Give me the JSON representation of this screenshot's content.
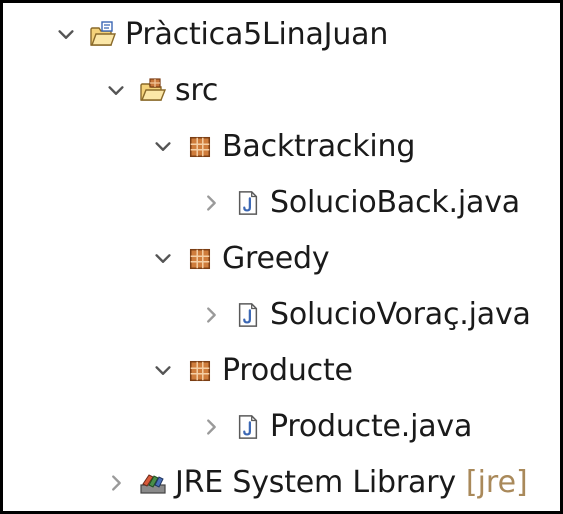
{
  "tree": {
    "project": {
      "label": "Pràctica5LinaJuan",
      "icon": "java-project-folder-icon",
      "expanded": true
    },
    "src": {
      "label": "src",
      "icon": "source-folder-icon",
      "expanded": true
    },
    "packages": [
      {
        "label": "Backtracking",
        "icon": "package-icon",
        "expanded": true,
        "files": [
          {
            "label": "SolucioBack.java",
            "icon": "java-file-icon",
            "expanded": false
          }
        ]
      },
      {
        "label": "Greedy",
        "icon": "package-icon",
        "expanded": true,
        "files": [
          {
            "label": "SolucioVoraç.java",
            "icon": "java-file-icon",
            "expanded": false
          }
        ]
      },
      {
        "label": "Producte",
        "icon": "package-icon",
        "expanded": true,
        "files": [
          {
            "label": "Producte.java",
            "icon": "java-file-icon",
            "expanded": false
          }
        ]
      }
    ],
    "library": {
      "label": "JRE System Library",
      "decoration": "[jre]",
      "icon": "library-icon",
      "expanded": false
    }
  },
  "colors": {
    "text": "#1a1a1a",
    "decoration": "#a9895a",
    "chevron": "#555555",
    "package": "#b3652b",
    "folder": "#e8b552",
    "javaFile": "#3b67b4"
  }
}
